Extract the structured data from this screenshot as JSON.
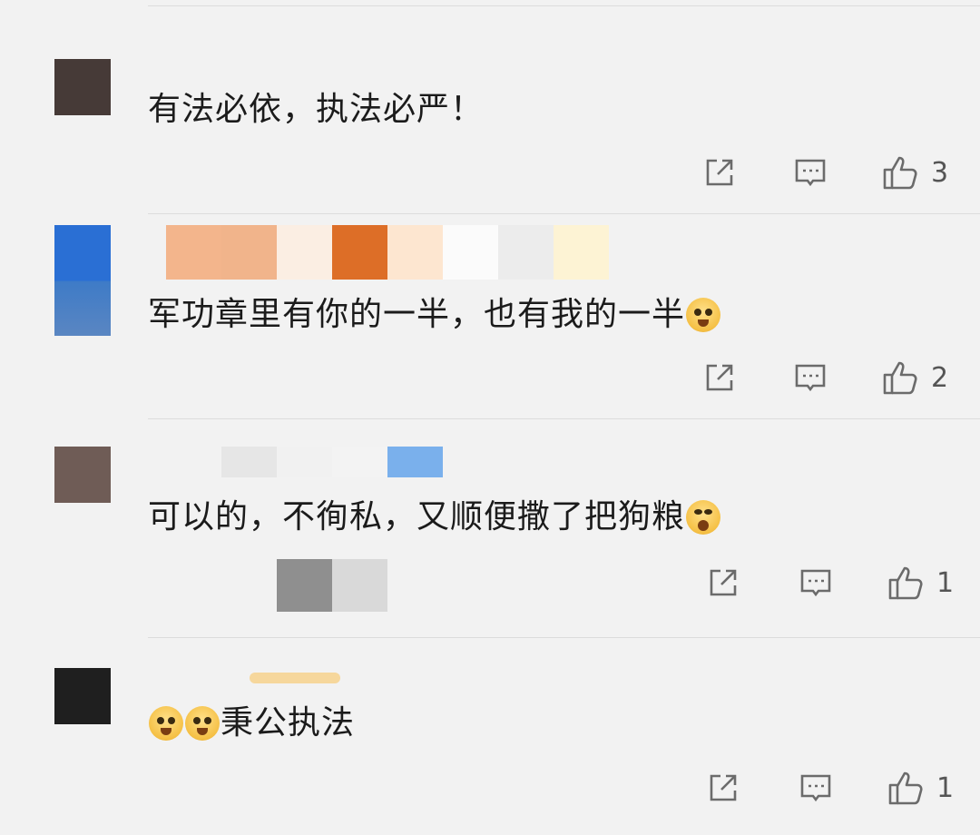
{
  "comments": [
    {
      "text": "有法必依，执法必严！",
      "emojis_before": [],
      "emojis_after": [],
      "likes": "3"
    },
    {
      "text": "军功章里有你的一半，也有我的一半",
      "emojis_before": [],
      "emojis_after": [
        "doge-emoji"
      ],
      "likes": "2"
    },
    {
      "text": "可以的，不徇私，又顺便撒了把狗粮",
      "emojis_before": [],
      "emojis_after": [
        "shocked-emoji"
      ],
      "likes": "1"
    },
    {
      "text": "秉公执法",
      "emojis_before": [
        "doge-emoji",
        "doge-emoji"
      ],
      "emojis_after": [],
      "likes": "1"
    }
  ],
  "icons": {
    "share": "share-icon",
    "reply": "comment-icon",
    "like": "thumbs-up-icon"
  },
  "colors": {
    "background": "#f2f2f2",
    "text": "#1b1b1b",
    "icon": "#6b6b6b",
    "divider": "#dcdcdc"
  }
}
